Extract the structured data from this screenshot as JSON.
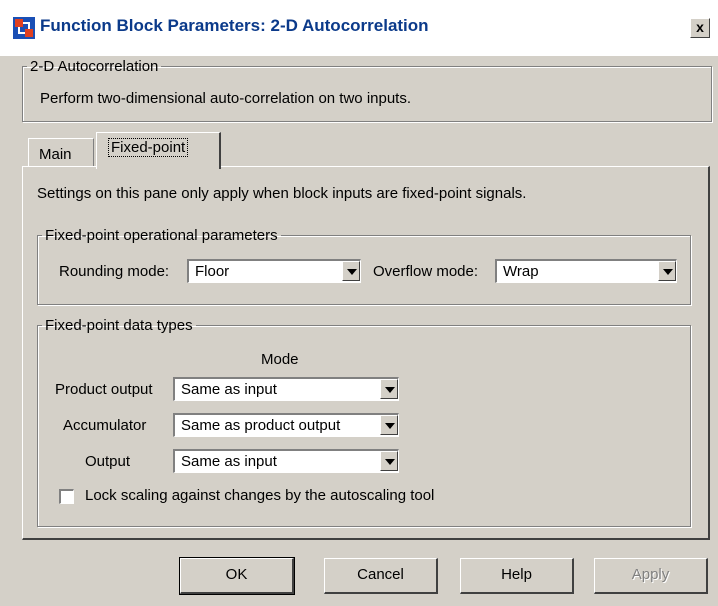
{
  "window": {
    "title": "Function Block Parameters: 2-D Autocorrelation",
    "close_label": "x"
  },
  "description": {
    "group_title": "2-D Autocorrelation",
    "text": "Perform two-dimensional auto-correlation on two inputs."
  },
  "tabs": [
    {
      "label": "Main",
      "selected": false
    },
    {
      "label": "Fixed-point",
      "selected": true
    }
  ],
  "panel": {
    "note": "Settings on this pane only apply when block inputs are fixed-point signals.",
    "ops_group": {
      "title": "Fixed-point operational parameters",
      "rounding_label": "Rounding mode:",
      "rounding_value": "Floor",
      "overflow_label": "Overflow mode:",
      "overflow_value": "Wrap"
    },
    "types_group": {
      "title": "Fixed-point data types",
      "mode_header": "Mode",
      "rows": [
        {
          "label": "Product output",
          "value": "Same as input"
        },
        {
          "label": "Accumulator",
          "value": "Same as product output"
        },
        {
          "label": "Output",
          "value": "Same as input"
        }
      ],
      "lock_label": "Lock scaling against changes by the autoscaling tool",
      "lock_checked": false
    }
  },
  "buttons": {
    "ok": "OK",
    "cancel": "Cancel",
    "help": "Help",
    "apply": "Apply"
  },
  "icons": {
    "title_icon": "simulink-block-icon",
    "dropdown": "chevron-down-icon"
  }
}
